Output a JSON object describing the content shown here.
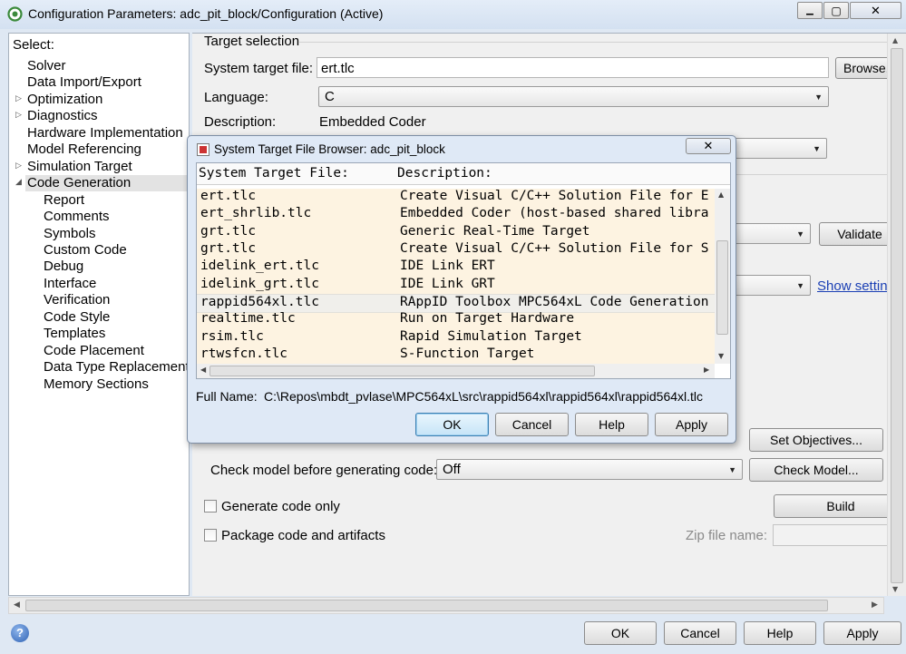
{
  "window": {
    "title": "Configuration Parameters: adc_pit_block/Configuration (Active)",
    "minimize": "▁",
    "maximize": "▢",
    "close": "✕"
  },
  "sidebar": {
    "header": "Select:",
    "items": [
      {
        "label": "Solver",
        "expander": "",
        "level": 0
      },
      {
        "label": "Data Import/Export",
        "expander": "",
        "level": 0
      },
      {
        "label": "Optimization",
        "expander": "▷",
        "level": 0
      },
      {
        "label": "Diagnostics",
        "expander": "▷",
        "level": 0
      },
      {
        "label": "Hardware Implementation",
        "expander": "",
        "level": 0
      },
      {
        "label": "Model Referencing",
        "expander": "",
        "level": 0
      },
      {
        "label": "Simulation Target",
        "expander": "▷",
        "level": 0
      },
      {
        "label": "Code Generation",
        "expander": "◢",
        "level": 0,
        "selected": true
      },
      {
        "label": "Report",
        "expander": "",
        "level": 1
      },
      {
        "label": "Comments",
        "expander": "",
        "level": 1
      },
      {
        "label": "Symbols",
        "expander": "",
        "level": 1
      },
      {
        "label": "Custom Code",
        "expander": "",
        "level": 1
      },
      {
        "label": "Debug",
        "expander": "",
        "level": 1
      },
      {
        "label": "Interface",
        "expander": "",
        "level": 1
      },
      {
        "label": "Verification",
        "expander": "",
        "level": 1
      },
      {
        "label": "Code Style",
        "expander": "",
        "level": 1
      },
      {
        "label": "Templates",
        "expander": "",
        "level": 1
      },
      {
        "label": "Code Placement",
        "expander": "",
        "level": 1
      },
      {
        "label": "Data Type Replacement",
        "expander": "",
        "level": 1
      },
      {
        "label": "Memory Sections",
        "expander": "",
        "level": 1
      }
    ]
  },
  "main": {
    "group_title": "Target selection",
    "system_target_file_label": "System target file:",
    "system_target_file_value": "ert.tlc",
    "browse_label": "Browse...",
    "language_label": "Language:",
    "language_value": "C",
    "description_label": "Description:",
    "description_value": "Embedded Coder",
    "validate_label": "Validate",
    "show_settings_label": "Show settings",
    "set_objectives_label": "Set Objectives...",
    "check_model_label": "Check model before generating code:",
    "check_model_value": "Off",
    "check_model_button": "Check Model...",
    "generate_code_only_label": "Generate code only",
    "build_label": "Build",
    "package_code_label": "Package code and artifacts",
    "zip_file_label": "Zip file name:",
    "zip_file_value": ""
  },
  "footer": {
    "help_icon": "?",
    "ok_label": "OK",
    "cancel_label": "Cancel",
    "help_label": "Help",
    "apply_label": "Apply"
  },
  "dialog": {
    "title": "System Target File Browser: adc_pit_block",
    "close": "✕",
    "col_file": "System Target File:",
    "col_desc": "Description:",
    "rows": [
      {
        "file": "ert.tlc",
        "desc": "Create Visual C/C++ Solution File for E"
      },
      {
        "file": "ert_shrlib.tlc",
        "desc": "Embedded Coder (host-based shared libra"
      },
      {
        "file": "grt.tlc",
        "desc": "Generic Real-Time Target"
      },
      {
        "file": "grt.tlc",
        "desc": "Create Visual C/C++ Solution File for S"
      },
      {
        "file": "idelink_ert.tlc",
        "desc": "IDE Link ERT"
      },
      {
        "file": "idelink_grt.tlc",
        "desc": "IDE Link GRT"
      },
      {
        "file": "rappid564xl.tlc",
        "desc": "RAppID Toolbox MPC564xL Code Generation",
        "selected": true
      },
      {
        "file": "realtime.tlc",
        "desc": "Run on Target Hardware"
      },
      {
        "file": "rsim.tlc",
        "desc": "Rapid Simulation Target"
      },
      {
        "file": "rtwsfcn.tlc",
        "desc": "S-Function Target"
      }
    ],
    "full_name_label": "Full Name:",
    "full_name_value": "C:\\Repos\\mbdt_pvlase\\MPC564xL\\src\\rappid564xl\\rappid564xl\\rappid564xl.tlc",
    "ok_label": "OK",
    "cancel_label": "Cancel",
    "help_label": "Help",
    "apply_label": "Apply"
  },
  "colors": {
    "row_bg": "#fdf3e1",
    "selected_row_bg": "#f0efeb",
    "link": "#1a3fb4",
    "title_bar": "#dde8f5"
  }
}
